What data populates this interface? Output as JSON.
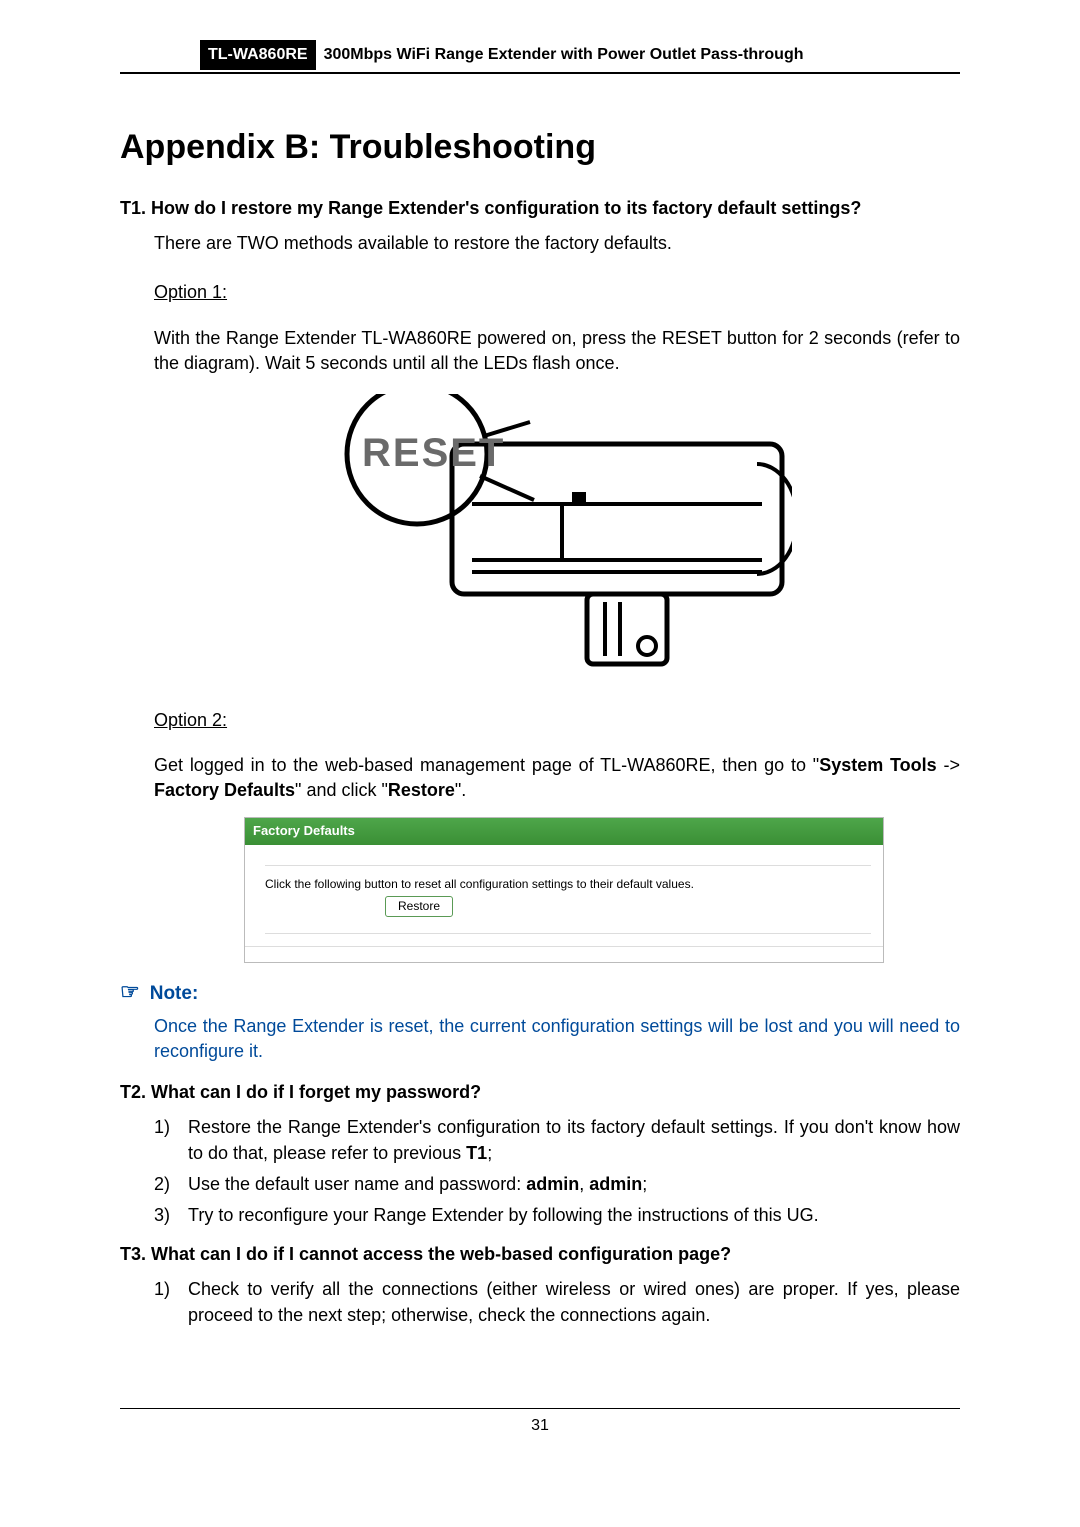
{
  "header": {
    "model": "TL-WA860RE",
    "description": "300Mbps WiFi Range Extender with Power Outlet Pass-through"
  },
  "title": "Appendix B: Troubleshooting",
  "t1": {
    "num": "T1.",
    "title": "How do I restore my Range Extender's configuration to its factory default settings?",
    "intro": "There are TWO methods available to restore the factory defaults.",
    "option1_label": "Option 1:",
    "option1_text": "With the Range Extender TL-WA860RE powered on, press the RESET button for 2 seconds (refer to the diagram). Wait 5 seconds until all the LEDs flash once.",
    "reset_label": "RESET",
    "option2_label": "Option 2:",
    "option2_text_pre": "Get logged in to the web-based management page of TL-WA860RE, then go to \"",
    "system_tools": "System Tools",
    "arrow": " -> ",
    "factory_defaults": "Factory Defaults",
    "option2_text_mid": "\" and click \"",
    "restore_word": "Restore",
    "option2_text_end": "\".",
    "panel_header": "Factory Defaults",
    "panel_instruction": "Click the following button to reset all configuration settings to their default values.",
    "panel_button": "Restore"
  },
  "note": {
    "icon": "☞",
    "label": "Note:",
    "text": "Once the Range Extender is reset, the current configuration settings will be lost and you will need to reconfigure it."
  },
  "t2": {
    "num": "T2.",
    "title": "What can I do if I forget my password?",
    "step1_a": "Restore the Range Extender's configuration to its factory default settings. If you don't know how to do that, please refer to previous ",
    "step1_b": "T1",
    "step1_c": ";",
    "step2_a": "Use the default user name and password: ",
    "step2_b": "admin",
    "step2_c": ", ",
    "step2_d": "admin",
    "step2_e": ";",
    "step3": "Try to reconfigure your Range Extender by following the instructions of this UG."
  },
  "t3": {
    "num": "T3.",
    "title": "What can I do if I cannot access the web-based configuration page?",
    "step1": "Check to verify all the connections (either wireless or wired ones) are proper. If yes, please proceed to the next step; otherwise, check the connections again."
  },
  "page_number": "31"
}
